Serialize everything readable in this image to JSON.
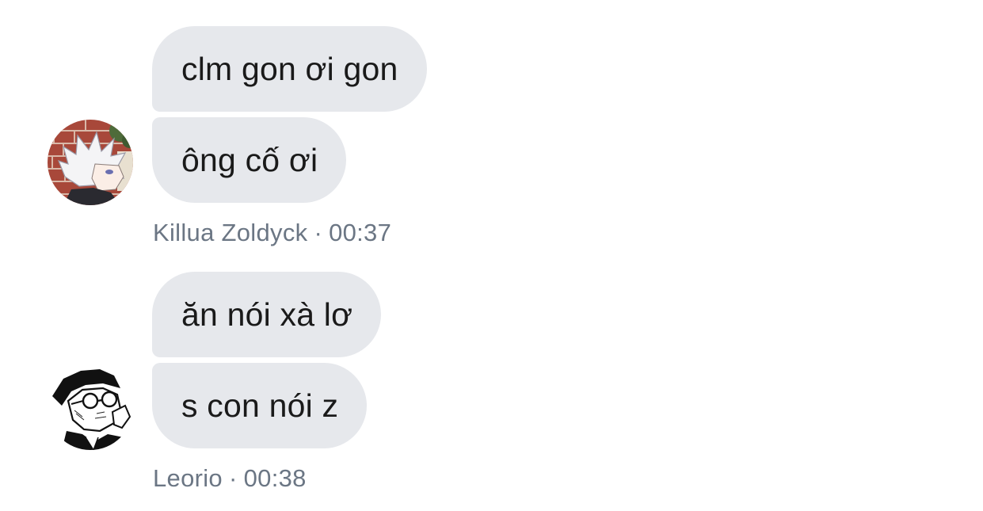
{
  "messages": [
    {
      "sender": "Killua Zoldyck",
      "time": "00:37",
      "avatar_icon": "white-haired-anime-avatar",
      "bubbles": [
        "clm gon ơi gon",
        "ông cố ơi"
      ]
    },
    {
      "sender": "Leorio",
      "time": "00:38",
      "avatar_icon": "sketch-glasses-anime-avatar",
      "bubbles": [
        "ăn nói xà lơ",
        "s con nói z"
      ]
    }
  ],
  "separator": "·",
  "colors": {
    "bubble_bg": "#e6e8ec",
    "text": "#1a1a1a",
    "meta_text": "#6b7684",
    "background": "#ffffff"
  }
}
